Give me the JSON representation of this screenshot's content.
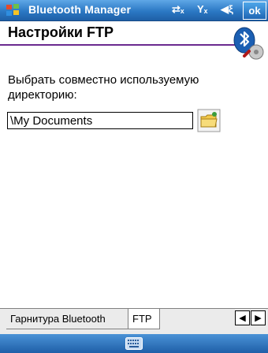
{
  "titlebar": {
    "app_title": "Bluetooth Manager",
    "ok_label": "ok",
    "icons": [
      "start-icon",
      "connectivity-icon",
      "signal-icon",
      "volume-icon"
    ]
  },
  "page": {
    "title": "Настройки FTP",
    "description": "Выбрать совместно используемую директорию:",
    "directory_value": "\\My Documents"
  },
  "tabs": [
    {
      "label": "Гарнитура Bluetooth",
      "active": false
    },
    {
      "label": "FTP",
      "active": true
    }
  ],
  "colors": {
    "titlebar": "#2b78c4",
    "title_rule": "#6a2a8f",
    "bottombar": "#1f5fa8"
  }
}
